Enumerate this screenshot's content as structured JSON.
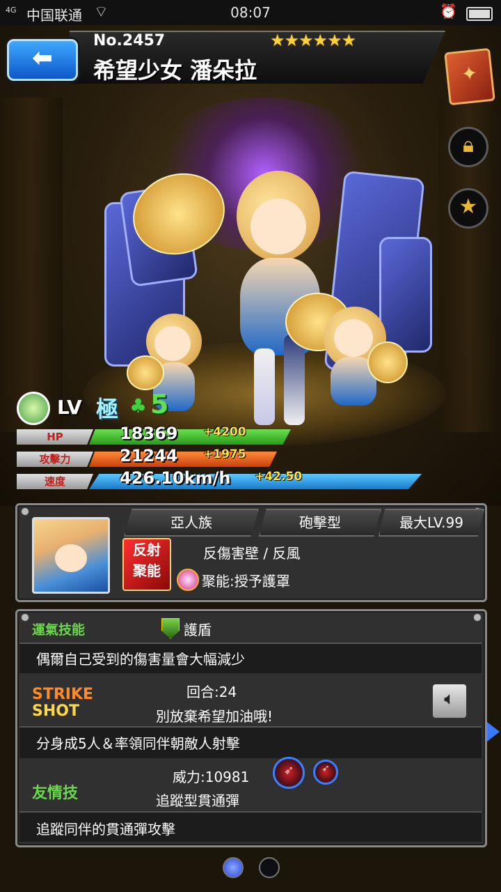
{
  "status_bar": {
    "signal": "4G",
    "carrier": "中国联通",
    "time": "08:07"
  },
  "header": {
    "number": "No.2457",
    "stars": "★★★★★★",
    "name": "希望少女 潘朵拉"
  },
  "level": {
    "label": "LV",
    "rank": "極",
    "plus": "5"
  },
  "stats": {
    "hp": {
      "label": "HP",
      "value": "18369",
      "bonus": "+4200",
      "color": "#3fbf2a"
    },
    "attack": {
      "label": "攻擊力",
      "value": "21244",
      "bonus": "+1975",
      "color": "#e0601e"
    },
    "speed": {
      "label": "速度",
      "value": "426.10km/h",
      "bonus": "+42.50",
      "color": "#2aa0e8"
    }
  },
  "info": {
    "race": "亞人族",
    "type": "砲擊型",
    "max_lv": "最大LV.99",
    "ability_badge_line1": "反射",
    "ability_badge_line2": "聚能",
    "abilities": "反傷害壁 / 反風",
    "gauge": "聚能:授予護罩"
  },
  "luck_skill": {
    "label": "運氣技能",
    "name": "護盾",
    "description": "偶爾自己受到的傷害量會大幅減少"
  },
  "strike_shot": {
    "label_line1": "STRIKE",
    "label_line2": "SHOT",
    "turns": "回合:24",
    "name": "別放棄希望加油哦!",
    "description": "分身成5人＆率領同伴朝敵人射擊"
  },
  "friendship": {
    "label": "友情技",
    "power": "威力:10981",
    "name": "追蹤型貫通彈",
    "description": "追蹤同伴的貫通彈攻擊"
  },
  "icons": {
    "back": "arrow-left-icon",
    "book": "book-icon",
    "lock": "lock-icon",
    "star": "star-icon",
    "sound": "speaker-icon"
  },
  "pagination": {
    "current": 1,
    "total": 2
  }
}
